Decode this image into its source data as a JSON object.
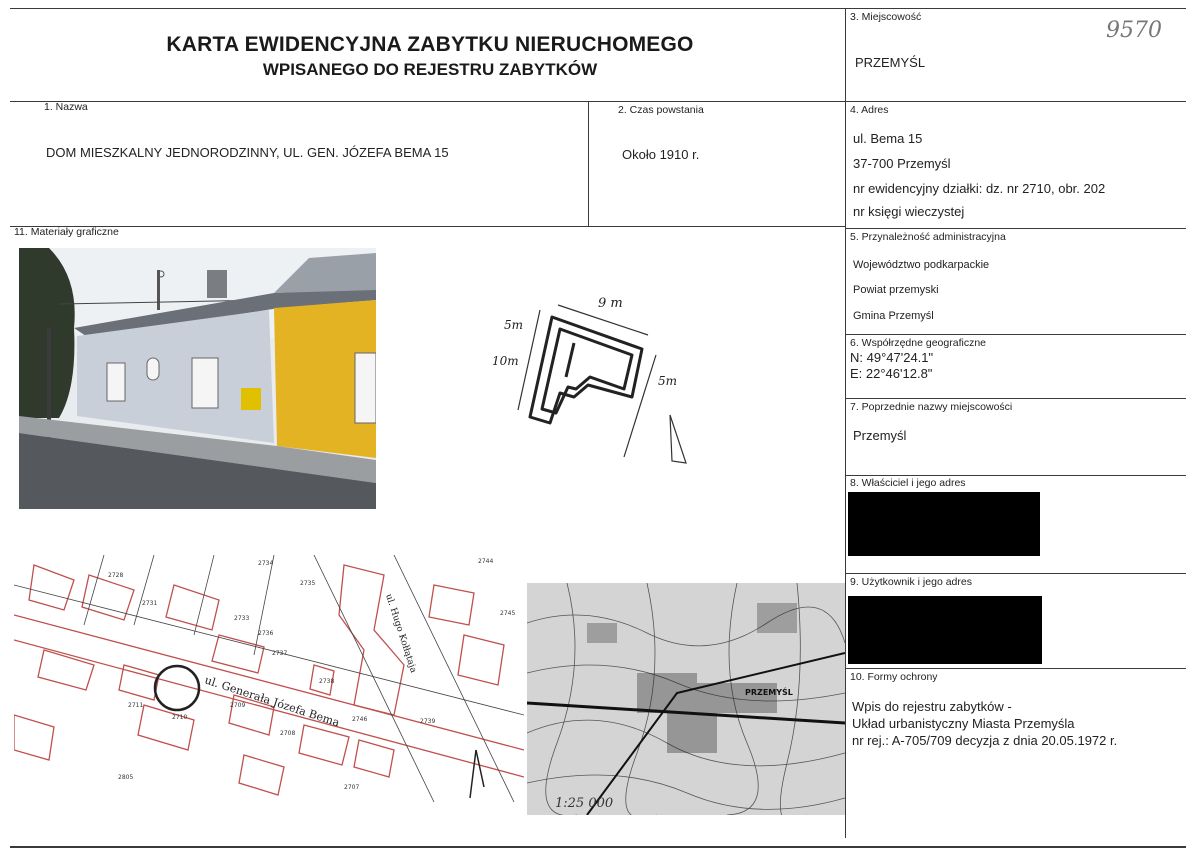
{
  "header": {
    "title_line1": "KARTA EWIDENCYJNA ZABYTKU NIERUCHOMEGO",
    "title_line2": "WPISANEGO DO REJESTRU ZABYTKÓW",
    "stamp_number": "9570"
  },
  "fields": {
    "f1_label": "1.   Nazwa",
    "f1_value": "DOM MIESZKALNY JEDNORODZINNY, UL. GEN. JÓZEFA BEMA 15",
    "f2_label": "2.   Czas powstania",
    "f2_value": "Około 1910 r.",
    "f3_label": "3. Miejscowość",
    "f3_value": "PRZEMYŚL",
    "f4_label": "4. Adres",
    "f4_lines": [
      "ul. Bema 15",
      "37-700 Przemyśl",
      "nr ewidencyjny działki: dz. nr 2710, obr. 202",
      "nr księgi wieczystej"
    ],
    "f5_label": "5. Przynależność administracyjna",
    "f5_lines": [
      "Województwo  podkarpackie",
      "Powiat  przemyski",
      "Gmina  Przemyśl"
    ],
    "f6_label": "6. Współrzędne geograficzne",
    "f6_lines": [
      "N: 49°47'24.1\"",
      "E: 22°46'12.8\""
    ],
    "f7_label": "7. Poprzednie nazwy miejscowości",
    "f7_value": "Przemyśl",
    "f8_label": "8. Właściciel i jego adres",
    "f9_label": "9. Użytkownik i jego adres",
    "f10_label": "10. Formy ochrony",
    "f10_lines": [
      "Wpis do rejestru zabytków -",
      "Układ urbanistyczny Miasta Przemyśla",
      "nr rej.: A-705/709 decyzja z dnia 20.05.1972 r."
    ],
    "f11_label": "11. Materiały graficzne"
  },
  "sketch": {
    "dim_top": "9 m",
    "dim_left_top": "5m",
    "dim_left": "10m",
    "dim_right": "5m"
  },
  "cadastral_map": {
    "street1": "ul. Generała Józefa Bema",
    "street2": "ul. Hugo Kołłątaja",
    "parcels": [
      "2728",
      "2731",
      "2734",
      "2735",
      "2733",
      "2736",
      "2737",
      "2738",
      "2744",
      "2745",
      "2711",
      "2710",
      "2709",
      "2708",
      "2746",
      "2739",
      "2707",
      "2805"
    ]
  },
  "topo_map": {
    "city_label": "PRZEMYŚL",
    "scale": "1:25 000"
  }
}
